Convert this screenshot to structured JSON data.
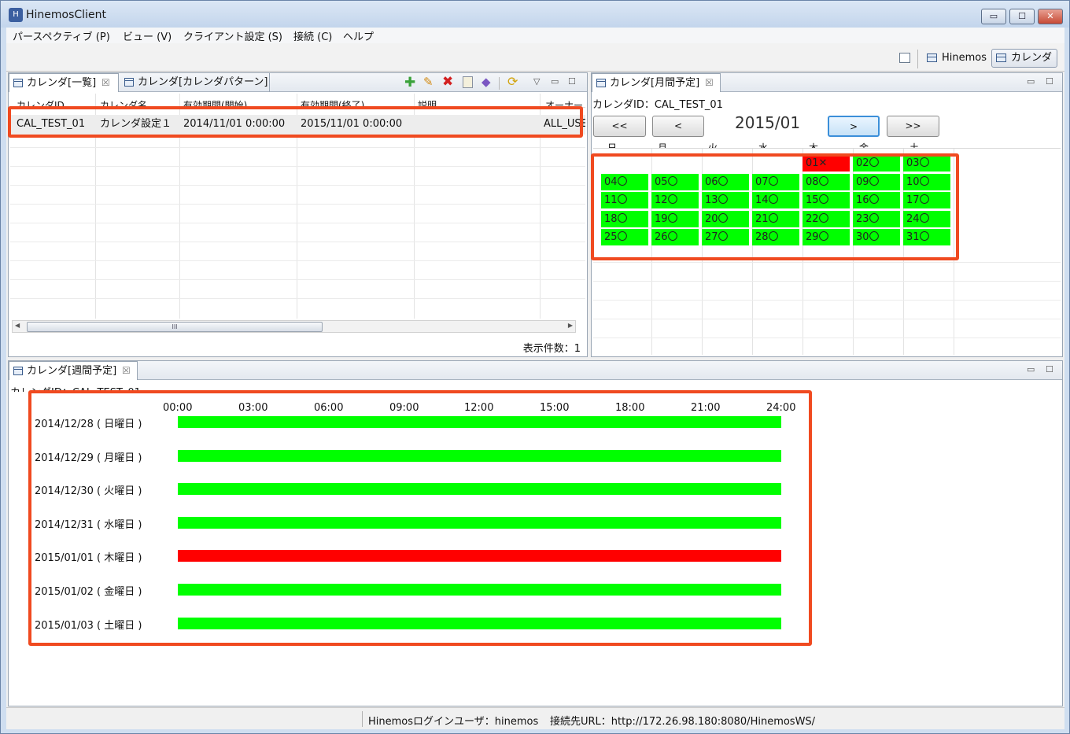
{
  "window": {
    "title": "HinemosClient",
    "icon": "hinemos-app-icon",
    "controls": {
      "minimize": "▭",
      "maximize": "☐",
      "close": "✕"
    }
  },
  "menu": [
    "パースペクティブ (P)",
    "ビュー (V)",
    "クライアント設定 (S)",
    "接続 (C)",
    "ヘルプ"
  ],
  "perspectives": [
    {
      "label": "Hinemos",
      "active": false
    },
    {
      "label": "カレンダ",
      "active": true
    }
  ],
  "list_view": {
    "tabs": [
      "カレンダ[一覧]",
      "カレンダ[カレンダパターン]"
    ],
    "columns": [
      "カレンダID",
      "カレンダ名",
      "有効期間(開始)",
      "有効期間(終了)",
      "説明",
      "オーナー"
    ],
    "rows": [
      {
        "id": "CAL_TEST_01",
        "name": "カレンダ設定１",
        "start": "2014/11/01 0:00:00",
        "end": "2015/11/01 0:00:00",
        "desc": "",
        "owner": "ALL_USERS"
      }
    ],
    "count_label": "表示件数：1",
    "scroll_thumb": "III"
  },
  "month_view": {
    "tab": "カレンダ[月間予定]",
    "calendar_id_label": "カレンダID：CAL_TEST_01",
    "month": "2015/01",
    "nav": [
      "<<",
      "<",
      ">",
      ">>"
    ],
    "weekdays": [
      "日",
      "月",
      "火",
      "水",
      "木",
      "金",
      "土"
    ],
    "days": [
      {
        "label": "01✕",
        "status": "ng"
      },
      {
        "label": "02〇",
        "status": "ok"
      },
      {
        "label": "03〇",
        "status": "ok"
      },
      {
        "label": "04〇",
        "status": "ok"
      },
      {
        "label": "05〇",
        "status": "ok"
      },
      {
        "label": "06〇",
        "status": "ok"
      },
      {
        "label": "07〇",
        "status": "ok"
      },
      {
        "label": "08〇",
        "status": "ok"
      },
      {
        "label": "09〇",
        "status": "ok"
      },
      {
        "label": "10〇",
        "status": "ok"
      },
      {
        "label": "11〇",
        "status": "ok"
      },
      {
        "label": "12〇",
        "status": "ok"
      },
      {
        "label": "13〇",
        "status": "ok"
      },
      {
        "label": "14〇",
        "status": "ok"
      },
      {
        "label": "15〇",
        "status": "ok"
      },
      {
        "label": "16〇",
        "status": "ok"
      },
      {
        "label": "17〇",
        "status": "ok"
      },
      {
        "label": "18〇",
        "status": "ok"
      },
      {
        "label": "19〇",
        "status": "ok"
      },
      {
        "label": "20〇",
        "status": "ok"
      },
      {
        "label": "21〇",
        "status": "ok"
      },
      {
        "label": "22〇",
        "status": "ok"
      },
      {
        "label": "23〇",
        "status": "ok"
      },
      {
        "label": "24〇",
        "status": "ok"
      },
      {
        "label": "25〇",
        "status": "ok"
      },
      {
        "label": "26〇",
        "status": "ok"
      },
      {
        "label": "27〇",
        "status": "ok"
      },
      {
        "label": "28〇",
        "status": "ok"
      },
      {
        "label": "29〇",
        "status": "ok"
      },
      {
        "label": "30〇",
        "status": "ok"
      },
      {
        "label": "31〇",
        "status": "ok"
      }
    ]
  },
  "week_view": {
    "tab": "カレンダ[週間予定]",
    "calendar_id_label": "カレンダID：CAL_TEST_01",
    "hours": [
      "00:00",
      "03:00",
      "06:00",
      "09:00",
      "12:00",
      "15:00",
      "18:00",
      "21:00",
      "24:00"
    ],
    "days": [
      {
        "label": "2014/12/28 ( 日曜日 )",
        "status": "ok"
      },
      {
        "label": "2014/12/29 ( 月曜日 )",
        "status": "ok"
      },
      {
        "label": "2014/12/30 ( 火曜日 )",
        "status": "ok"
      },
      {
        "label": "2014/12/31 ( 水曜日 )",
        "status": "ok"
      },
      {
        "label": "2015/01/01 ( 木曜日 )",
        "status": "ng"
      },
      {
        "label": "2015/01/02 ( 金曜日 )",
        "status": "ok"
      },
      {
        "label": "2015/01/03 ( 土曜日 )",
        "status": "ok"
      }
    ]
  },
  "status_bar": {
    "login_user": "Hinemosログインユーザ：hinemos",
    "url": "接続先URL：http://172.26.98.180:8080/HinemosWS/"
  },
  "colors": {
    "ok": "#00ff00",
    "ng": "#ff0000",
    "highlight": "#f04a20"
  },
  "toolbar_icons": [
    "add-icon",
    "edit-icon",
    "delete-icon",
    "copy-icon",
    "object-privilege-icon",
    "refresh-icon"
  ]
}
